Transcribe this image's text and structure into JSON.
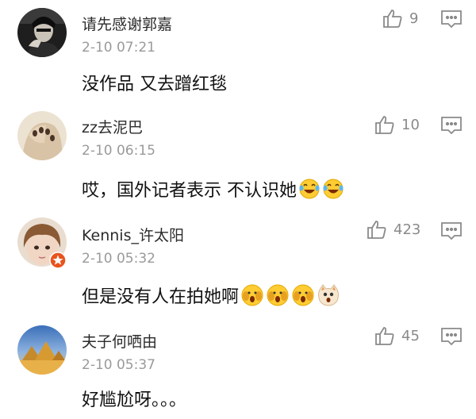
{
  "comments": [
    {
      "username": "请先感谢郭嘉",
      "time": "2-10 07:21",
      "text": "没作品 又去蹭红毯",
      "likes": "9"
    },
    {
      "username": "zz去泥巴",
      "time": "2-10 06:15",
      "text": "哎，国外记者表示 不认识她",
      "likes": "10",
      "emojis": [
        "laughing-tears-emoji",
        "laughing-tears-emoji"
      ]
    },
    {
      "username": "Kennis_许太阳",
      "time": "2-10 05:32",
      "text": "但是没有人在拍她啊",
      "likes": "423",
      "emojis": [
        "scared-face-emoji",
        "scared-face-emoji",
        "scared-face-emoji",
        "scared-cat-emoji"
      ]
    },
    {
      "username": "夫子何哂由",
      "time": "2-10 05:37",
      "text": "好尴尬呀。。。",
      "likes": "45"
    }
  ],
  "colors": {
    "username": "#2b2b2b",
    "time": "#9a9a9a",
    "text": "#111111",
    "icon": "#8a8a8a",
    "badge": "#e8541e"
  },
  "icons": {
    "like": "thumbs-up-icon",
    "reply": "comment-bubble-icon",
    "badge": "star-badge-icon"
  }
}
